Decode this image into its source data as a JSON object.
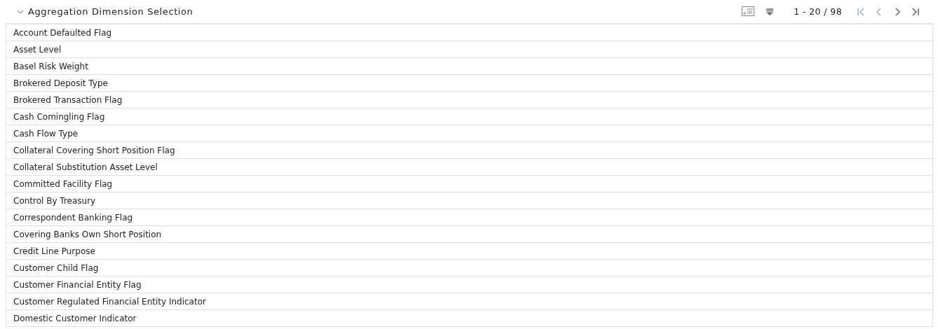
{
  "section": {
    "title": "Aggregation Dimension Selection",
    "expanded": true
  },
  "toolbar": {
    "range": "1 - 20 / 98",
    "nav": [
      {
        "kind": "first",
        "disabled": true
      },
      {
        "kind": "prev",
        "disabled": true
      },
      {
        "kind": "next",
        "disabled": false
      },
      {
        "kind": "last",
        "disabled": false
      }
    ]
  },
  "rows": [
    "Account Defaulted Flag",
    "Asset Level",
    "Basel Risk Weight",
    "Brokered Deposit Type",
    "Brokered Transaction Flag",
    "Cash Comingling Flag",
    "Cash Flow Type",
    "Collateral Covering Short Position Flag",
    "Collateral Substitution Asset Level",
    "Committed Facility Flag",
    "Control By Treasury",
    "Correspondent Banking Flag",
    "Covering Banks Own Short Position",
    "Credit Line Purpose",
    "Customer Child Flag",
    "Customer Financial Entity Flag",
    "Customer Regulated Financial Entity Indicator",
    "Domestic Customer Indicator"
  ]
}
